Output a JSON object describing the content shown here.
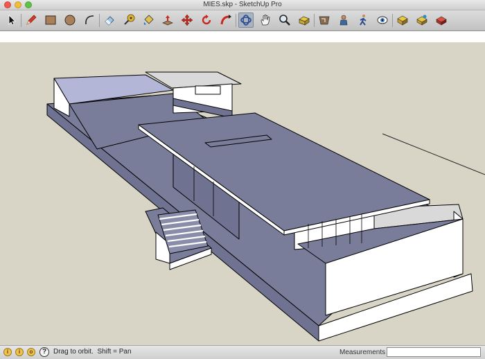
{
  "window": {
    "title": "MIES.skp - SketchUp Pro"
  },
  "toolbar": {
    "tools": [
      {
        "name": "select-tool"
      },
      {
        "name": "pencil-tool"
      },
      {
        "name": "rectangle-tool"
      },
      {
        "name": "circle-tool"
      },
      {
        "name": "arc-tool"
      },
      {
        "name": "eraser-tool"
      },
      {
        "name": "tape-measure-tool"
      },
      {
        "name": "paint-bucket-tool"
      },
      {
        "name": "push-pull-tool"
      },
      {
        "name": "move-tool"
      },
      {
        "name": "rotate-tool"
      },
      {
        "name": "follow-me-tool"
      },
      {
        "name": "orbit-tool"
      },
      {
        "name": "pan-tool"
      },
      {
        "name": "zoom-tool"
      },
      {
        "name": "zoom-extents-tool"
      },
      {
        "name": "previous-view-tool"
      },
      {
        "name": "position-camera-tool"
      },
      {
        "name": "walk-tool"
      },
      {
        "name": "look-around-tool"
      },
      {
        "name": "warehouse-tool"
      },
      {
        "name": "components-tool"
      },
      {
        "name": "extension-warehouse-tool"
      }
    ],
    "active_tool": "orbit-tool"
  },
  "status": {
    "hint": "Drag to orbit.  Shift = Pan",
    "measurements_label": "Measurements",
    "measurements_value": ""
  },
  "colors": {
    "sky": "#ffffff",
    "ground": "#d8d5c7",
    "face_top": "#7a7d99",
    "face_light": "#ffffff",
    "face_mid": "#6f7290",
    "edge": "#000000"
  }
}
